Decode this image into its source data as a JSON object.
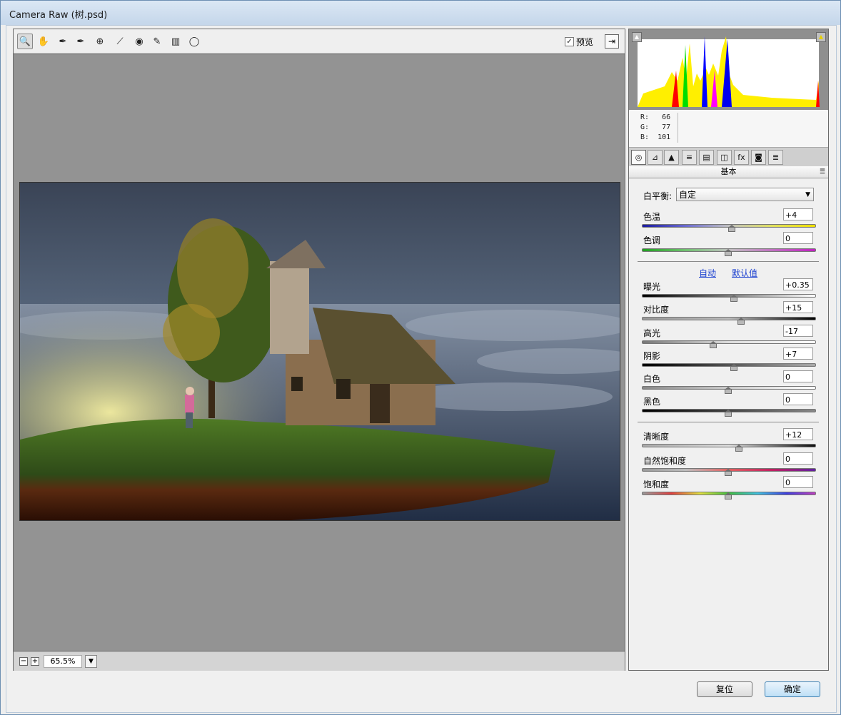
{
  "window": {
    "title": "Camera Raw (树.psd)"
  },
  "toolbar": {
    "tools": [
      {
        "name": "zoom-tool-icon",
        "glyph": "🔍"
      },
      {
        "name": "hand-tool-icon",
        "glyph": "✋"
      },
      {
        "name": "white-balance-tool-icon",
        "glyph": "✒"
      },
      {
        "name": "color-sampler-tool-icon",
        "glyph": "✒"
      },
      {
        "name": "targeted-adjustment-tool-icon",
        "glyph": "⊕"
      },
      {
        "name": "straighten-tool-icon",
        "glyph": "⟋"
      },
      {
        "name": "red-eye-tool-icon",
        "glyph": "◉"
      },
      {
        "name": "adjustment-brush-icon",
        "glyph": "✎"
      },
      {
        "name": "graduated-filter-icon",
        "glyph": "▥"
      },
      {
        "name": "radial-filter-icon",
        "glyph": "◯"
      }
    ],
    "preview_label": "预览",
    "preview_checked": "✓"
  },
  "status": {
    "zoom": "65.5%",
    "zoom_out": "−",
    "zoom_in": "+"
  },
  "histogram": {
    "r_label": "R:",
    "r": "66",
    "g_label": "G:",
    "g": "77",
    "b_label": "B:",
    "b": "101"
  },
  "panel": {
    "tabs": [
      "◎",
      "⊿",
      "▲",
      "≡",
      "▤",
      "◫",
      "fx",
      "◙",
      "≣"
    ],
    "section_title": "基本",
    "wb_label": "白平衡:",
    "wb_value": "自定",
    "auto_link": "自动",
    "default_link": "默认值",
    "sliders": {
      "temperature": {
        "label": "色温",
        "value": "+4",
        "pos": 0.52
      },
      "tint": {
        "label": "色调",
        "value": "0",
        "pos": 0.5
      },
      "exposure": {
        "label": "曝光",
        "value": "+0.35",
        "pos": 0.535
      },
      "contrast": {
        "label": "对比度",
        "value": "+15",
        "pos": 0.575
      },
      "highlights": {
        "label": "高光",
        "value": "-17",
        "pos": 0.415
      },
      "shadows": {
        "label": "阴影",
        "value": "+7",
        "pos": 0.535
      },
      "whites": {
        "label": "白色",
        "value": "0",
        "pos": 0.5
      },
      "blacks": {
        "label": "黑色",
        "value": "0",
        "pos": 0.5
      },
      "clarity": {
        "label": "清晰度",
        "value": "+12",
        "pos": 0.56
      },
      "vibrance": {
        "label": "自然饱和度",
        "value": "0",
        "pos": 0.5
      },
      "saturation": {
        "label": "饱和度",
        "value": "0",
        "pos": 0.5
      }
    }
  },
  "buttons": {
    "reset": "复位",
    "ok": "确定"
  },
  "colors": {
    "accent": "#1a3fd0",
    "canvas_bg": "#939393"
  }
}
